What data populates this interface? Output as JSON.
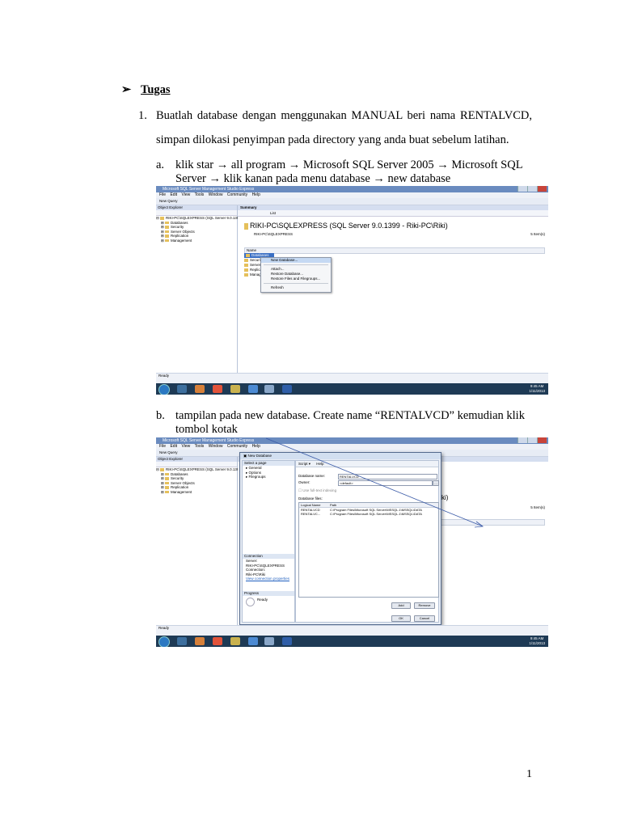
{
  "heading": {
    "arrow": "➢",
    "text": "Tugas"
  },
  "item1": {
    "number": "1.",
    "line1": "Buatlah database dengan menggunakan MANUAL beri nama RENTALVCD,",
    "line2": "simpan dilokasi penyimpan pada directory yang anda buat sebelum latihan."
  },
  "step_a": {
    "label": "a.",
    "line1": "klik star → all program → Microsoft SQL Server 2005 → Microsoft SQL",
    "line2": "Server → klik kanan pada menu database → new database"
  },
  "step_b": {
    "label": "b.",
    "line1": "tampilan pada new database. Create name “RENTALVCD” kemudian klik",
    "line2": "tombol kotak"
  },
  "ssms": {
    "title": "Microsoft SQL Server Management Studio Express",
    "menu": [
      "File",
      "Edit",
      "View",
      "Tools",
      "Window",
      "Community",
      "Help"
    ],
    "new_query": "New Query",
    "object_explorer": "Object Explorer",
    "server_node": "RIKI-PC\\SQLEXPRESS (SQL Server 9.0.1399 - R",
    "tree": [
      "Databases",
      "Security",
      "Server Objects",
      "Replication",
      "Management"
    ],
    "summary_tab": "Summary",
    "summary_list": "List",
    "summary_title": "RIKI-PC\\SQLEXPRESS (SQL Server 9.0.1399 - Riki-PC\\Riki)",
    "summary_sub": "RIKI-PC\\SQLEXPRESS",
    "items_count": "5 Item(s)",
    "name_col": "Name",
    "list_items": [
      "Databases",
      "Security",
      "Server Objects",
      "Replication",
      "Management"
    ],
    "status": "Ready",
    "clock_time": "9:45 AM",
    "clock_date": "1/11/2013",
    "partial_text": "ki)"
  },
  "context_menu": [
    "New Database...",
    "Attach...",
    "Restore Database...",
    "Restore Files and Filegroups...",
    "Refresh"
  ],
  "new_db_dialog": {
    "title": "New Database",
    "select_page": "Select a page",
    "pages": [
      "General",
      "Options",
      "Filegroups"
    ],
    "toolbar_script": "Script",
    "toolbar_help": "Help",
    "db_name_label": "Database name:",
    "db_name_value": "RENTALVCD",
    "owner_label": "Owner:",
    "owner_value": "<default>",
    "fulltext_label": "Use full-text indexing",
    "files_label": "Database files:",
    "files_headers": [
      "Logical Name",
      "Path"
    ],
    "files_rows": [
      [
        "RENTALVCD",
        "C:\\Program Files\\Microsoft SQL Server\\MSSQL.1\\MSSQL\\DATA"
      ],
      [
        "RENTALVC...",
        "C:\\Program Files\\Microsoft SQL Server\\MSSQL.1\\MSSQL\\DATA"
      ]
    ],
    "connection_section": "Connection",
    "server_label": "Server:",
    "server_value": "RIKI-PC\\SQLEXPRESS",
    "connection_label": "Connection:",
    "connection_value": "Riki-PC\\Riki",
    "view_props": "View connection properties",
    "progress_section": "Progress",
    "progress_value": "Ready",
    "add_btn": "Add",
    "remove_btn": "Remove",
    "ok_btn": "OK",
    "cancel_btn": "Cancel"
  },
  "page_number": "1"
}
